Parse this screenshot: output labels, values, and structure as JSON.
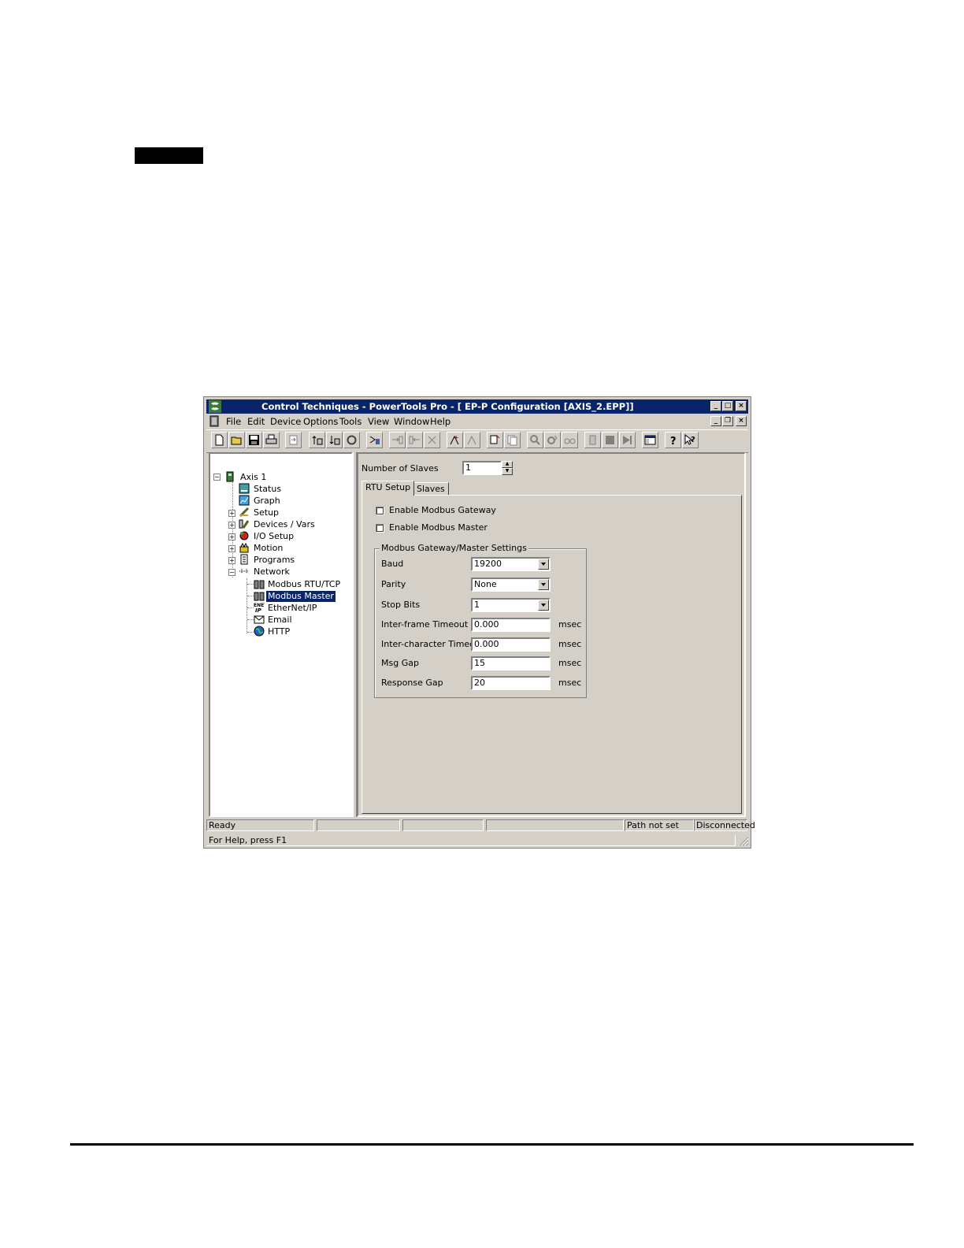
{
  "window": {
    "title": "Control Techniques - PowerTools Pro - [ EP-P Configuration  [AXIS_2.EPP]]",
    "controls": {
      "minimize": "_",
      "maximize": "□",
      "close": "×"
    },
    "doc_controls": {
      "minimize": "_",
      "restore": "❐",
      "close": "×"
    }
  },
  "menu": {
    "file": "File",
    "edit": "Edit",
    "device": "Device",
    "options": "Options",
    "tools": "Tools",
    "view": "View",
    "window": "Window",
    "help": "Help"
  },
  "toolbar": {
    "icons": [
      "new-icon",
      "open-icon",
      "save-icon",
      "print-icon",
      "export-icon",
      "upload-icon",
      "download-icon",
      "refresh-icon",
      "connect-icon",
      "add-right-icon",
      "add-left-icon",
      "delete-icon",
      "add-line-icon",
      "remove-line-icon",
      "copy-icon",
      "paste-icon",
      "find-icon",
      "find-next-icon",
      "replace-icon",
      "record-icon",
      "stop-icon",
      "play-icon",
      "window-icon",
      "help-icon",
      "context-help-icon"
    ]
  },
  "tree": {
    "root": "Axis 1",
    "items": [
      {
        "label": "Status",
        "icon": "status-icon"
      },
      {
        "label": "Graph",
        "icon": "graph-icon"
      },
      {
        "label": "Setup",
        "icon": "setup-icon",
        "expander": "+"
      },
      {
        "label": "Devices / Vars",
        "icon": "devices-icon",
        "expander": "+"
      },
      {
        "label": "I/O Setup",
        "icon": "io-icon",
        "expander": "+"
      },
      {
        "label": "Motion",
        "icon": "motion-icon",
        "expander": "+"
      },
      {
        "label": "Programs",
        "icon": "programs-icon",
        "expander": "+"
      },
      {
        "label": "Network",
        "icon": "network-icon",
        "expander": "−"
      }
    ],
    "network_children": [
      {
        "label": "Modbus RTU/TCP",
        "icon": "modbus-icon"
      },
      {
        "label": "Modbus Master",
        "icon": "modbus-master-icon",
        "selected": true
      },
      {
        "label": "EtherNet/IP",
        "icon": "ethernet-ip-icon"
      },
      {
        "label": "Email",
        "icon": "email-icon"
      },
      {
        "label": "HTTP",
        "icon": "http-icon"
      }
    ]
  },
  "form": {
    "num_slaves_label": "Number of Slaves",
    "num_slaves_value": "1",
    "tabs": [
      "RTU Setup",
      "Slaves"
    ],
    "enable_gateway": "Enable Modbus Gateway",
    "enable_master": "Enable Modbus Master",
    "group_title": "Modbus Gateway/Master Settings",
    "baud_label": "Baud",
    "baud_value": "19200",
    "parity_label": "Parity",
    "parity_value": "None",
    "stop_bits_label": "Stop Bits",
    "stop_bits_value": "1",
    "interframe_label": "Inter-frame Timeout",
    "interframe_value": "0.000",
    "interchar_label": "Inter-character Timeout",
    "interchar_value": "0.000",
    "msg_gap_label": "Msg Gap",
    "msg_gap_value": "15",
    "response_gap_label": "Response Gap",
    "response_gap_value": "20",
    "unit": "msec"
  },
  "status": {
    "ready": "Ready",
    "path": "Path not set",
    "connection": "Disconnected",
    "help": "For Help, press F1"
  },
  "colors": {
    "title_bar": "#0a246a",
    "face": "#d4d0c8",
    "selection": "#0a246a"
  }
}
